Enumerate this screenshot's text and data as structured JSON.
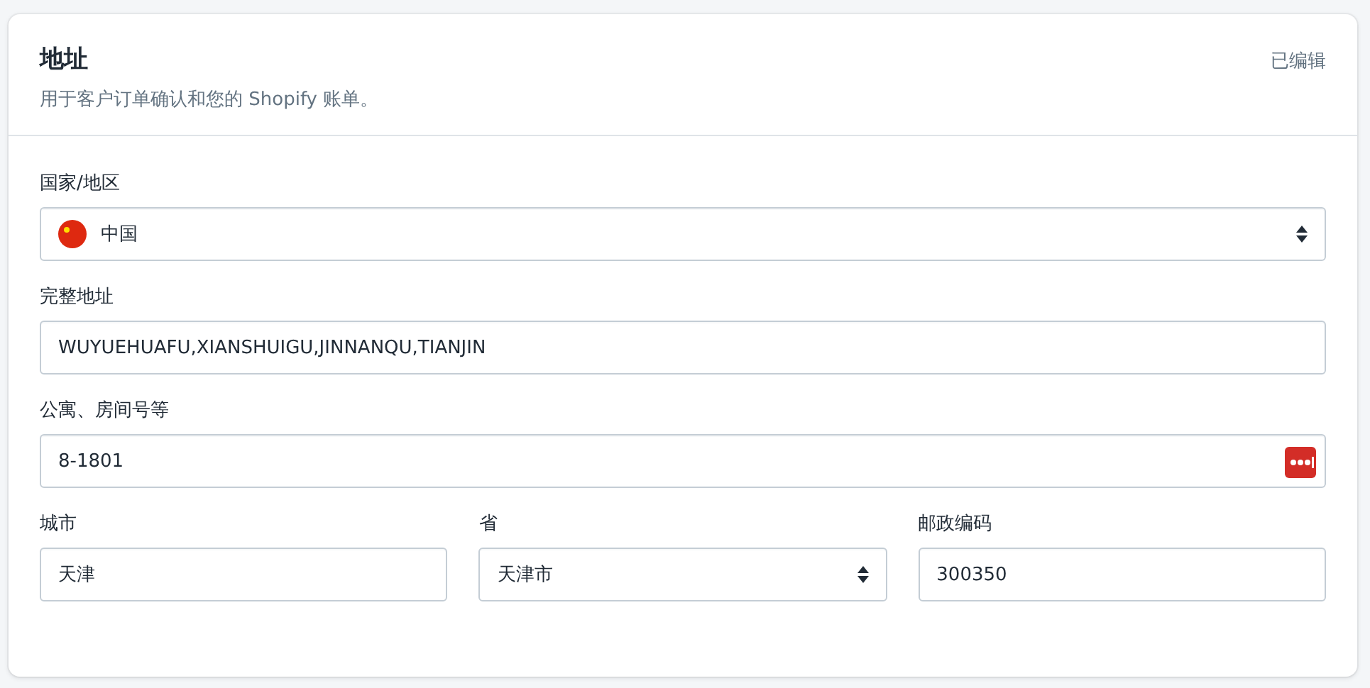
{
  "card": {
    "title": "地址",
    "subtitle": "用于客户订单确认和您的 Shopify 账单。",
    "status": "已编辑"
  },
  "rows": [
    [
      {
        "kind": "select",
        "label": "国家/地区",
        "value": "中国",
        "flag": true
      }
    ],
    [
      {
        "kind": "text",
        "label": "完整地址",
        "value": "WUYUEHUAFU,XIANSHUIGU,JINNANQU,TIANJIN"
      }
    ],
    [
      {
        "kind": "text",
        "label": "公寓、房间号等",
        "value": "8-1801",
        "autofill_badge": true
      }
    ],
    [
      {
        "kind": "text",
        "label": "城市",
        "value": "天津"
      },
      {
        "kind": "select",
        "label": "省",
        "value": "天津市"
      },
      {
        "kind": "text",
        "label": "邮政编码",
        "value": "300350"
      }
    ]
  ]
}
